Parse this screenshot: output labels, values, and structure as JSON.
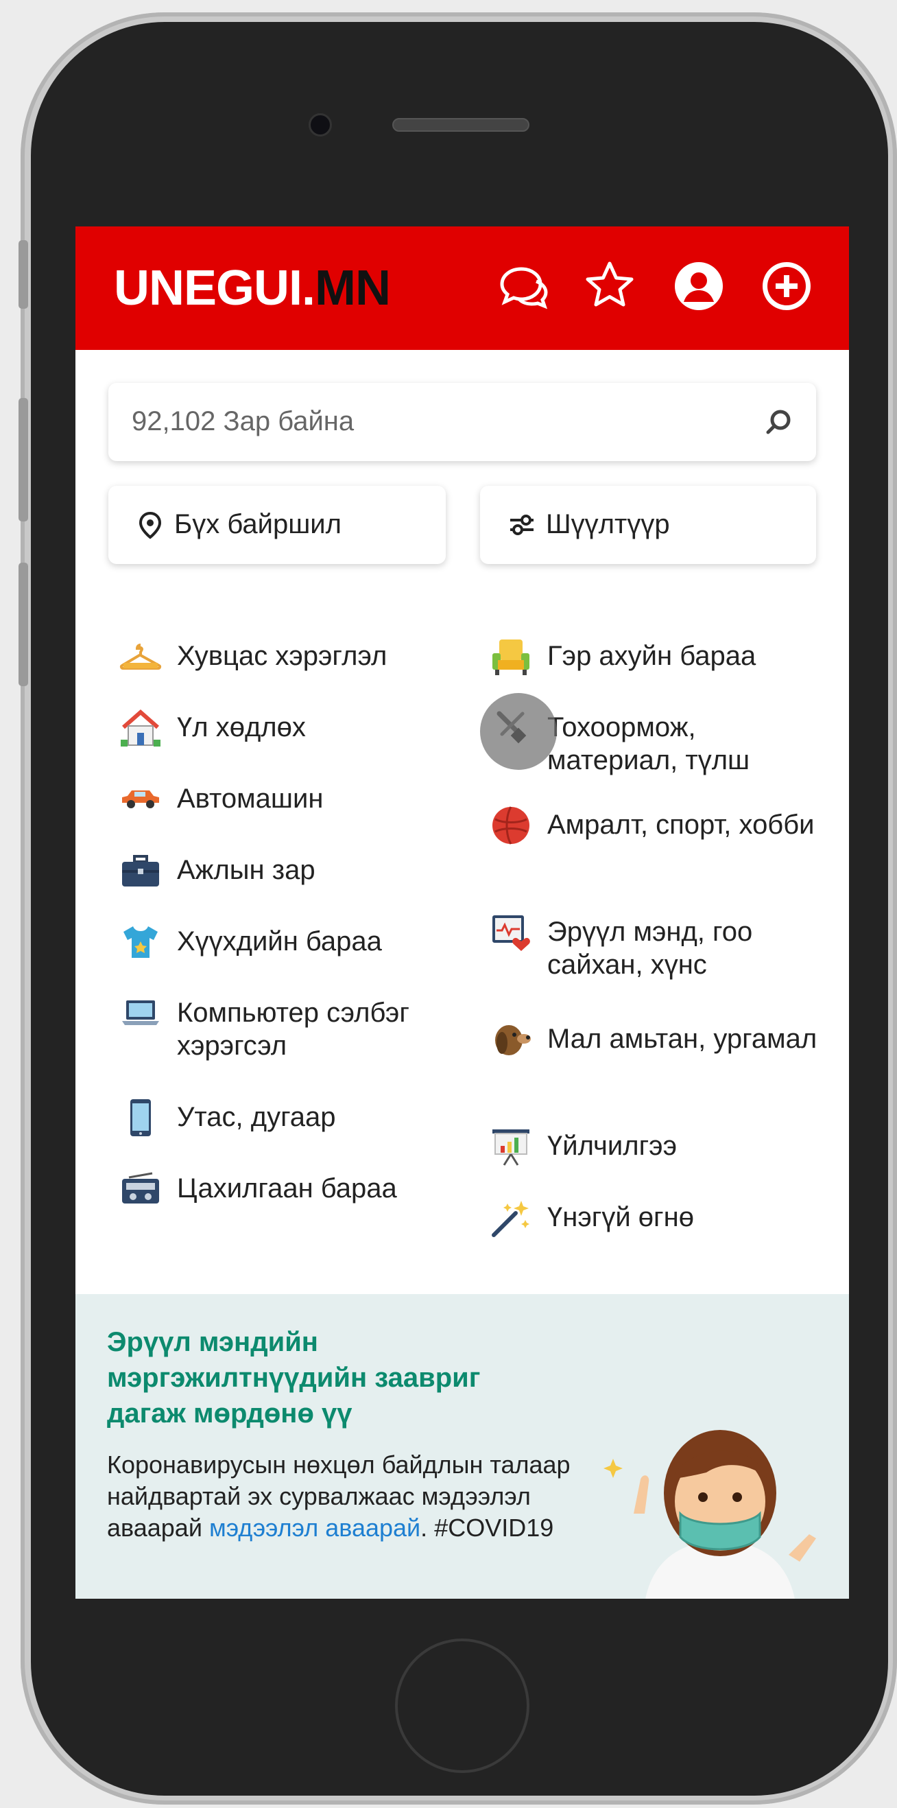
{
  "app": {
    "logo_part1": "UNEGUI.",
    "logo_part2": "MN"
  },
  "header_icons": [
    "chat-icon",
    "star-icon",
    "user-icon",
    "plus-icon"
  ],
  "search": {
    "placeholder": "92,102 Зар байна"
  },
  "filters": {
    "location_label": "Бүх байршил",
    "filter_label": "Шүүлтүүр"
  },
  "categories_left": [
    {
      "label": "Хувцас хэрэглэл",
      "icon": "hanger-icon"
    },
    {
      "label": "Үл хөдлөх",
      "icon": "house-icon"
    },
    {
      "label": "Автомашин",
      "icon": "car-icon"
    },
    {
      "label": "Ажлын зар",
      "icon": "briefcase-icon"
    },
    {
      "label": "Хүүхдийн бараа",
      "icon": "tshirt-icon"
    },
    {
      "label": "Компьютер сэлбэг хэрэгсэл",
      "icon": "laptop-icon"
    },
    {
      "label": "Утас, дугаар",
      "icon": "phone-icon"
    },
    {
      "label": "Цахилгаан бараа",
      "icon": "radio-icon"
    }
  ],
  "categories_right": [
    {
      "label": "Гэр ахуйн бараа",
      "icon": "armchair-icon"
    },
    {
      "label": "Тохоормож, материал, түлш",
      "icon": "tools-icon"
    },
    {
      "label": "Амралт, спорт, хобби",
      "icon": "ball-icon"
    },
    {
      "label": "Эрүүл мэнд, гоо сайхан, хүнс",
      "icon": "health-icon"
    },
    {
      "label": "Мал амьтан, ургамал",
      "icon": "dog-icon"
    },
    {
      "label": "Үйлчилгээ",
      "icon": "presentation-icon"
    },
    {
      "label": "Үнэгүй өгнө",
      "icon": "magic-wand-icon"
    }
  ],
  "banner": {
    "title": "Эрүүл мэндийн мэргэжилтнүүдийн заавриг дагаж мөрдөнө үү",
    "body": "Коронавирусын нөхцөл байдлын талаар найдвартай эх сурвалжаас мэдээлэл аваарай",
    "link": "мэдээлэл аваарай",
    "tag": "#COVID19"
  },
  "colors": {
    "header_red": "#e00000",
    "banner_bg": "#e5efef",
    "banner_title": "#0c8a6e",
    "link_blue": "#1e7fd1"
  }
}
